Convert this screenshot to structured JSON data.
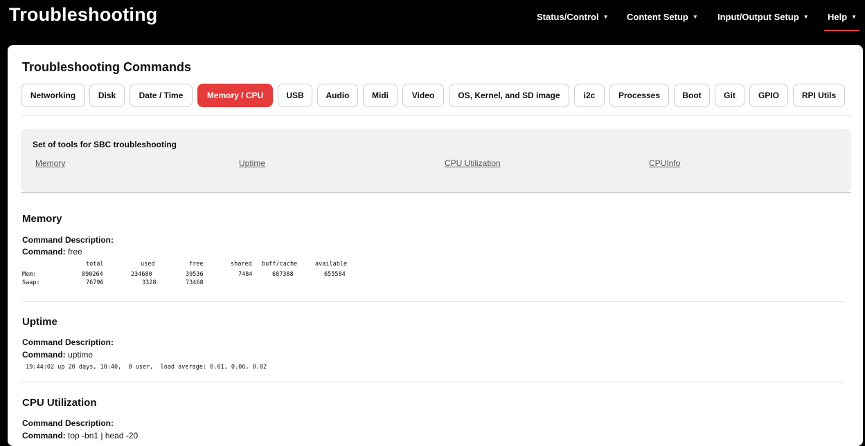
{
  "app": {
    "title": "Troubleshooting"
  },
  "nav": [
    {
      "label": "Status/Control"
    },
    {
      "label": "Content Setup"
    },
    {
      "label": "Input/Output Setup"
    },
    {
      "label": "Help"
    }
  ],
  "section_title": "Troubleshooting Commands",
  "tabs": [
    {
      "label": "Networking"
    },
    {
      "label": "Disk"
    },
    {
      "label": "Date / Time"
    },
    {
      "label": "Memory / CPU",
      "active": true
    },
    {
      "label": "USB"
    },
    {
      "label": "Audio"
    },
    {
      "label": "Midi"
    },
    {
      "label": "Video"
    },
    {
      "label": "OS, Kernel, and SD image"
    },
    {
      "label": "i2c"
    },
    {
      "label": "Processes"
    },
    {
      "label": "Boot"
    },
    {
      "label": "Git"
    },
    {
      "label": "GPIO"
    },
    {
      "label": "RPI Utils"
    }
  ],
  "tools": {
    "title": "Set of tools for SBC troubleshooting",
    "links": [
      "Memory",
      "Uptime",
      "CPU Utilization",
      "CPUInfo"
    ]
  },
  "commands": {
    "desc_label": "Command Description:",
    "cmd_label": "Command:",
    "memory": {
      "heading": "Memory",
      "command": "free",
      "columns": [
        "total",
        "used",
        "free",
        "shared",
        "buff/cache",
        "available"
      ],
      "rows": [
        [
          "Mem:",
          "890264",
          "234680",
          "39536",
          "7484",
          "687388",
          "655584"
        ],
        [
          "Swap:",
          "76796",
          "3328",
          "73468",
          "",
          "",
          ""
        ]
      ]
    },
    "uptime": {
      "heading": "Uptime",
      "command": "uptime",
      "output": " 19:44:02 up 20 days, 10:40,  0 user,  load average: 0.01, 0.06, 0.02"
    },
    "cpu": {
      "heading": "CPU Utilization",
      "command": "top -bn1 | head -20"
    }
  },
  "colors": {
    "accent": "#e53b3b",
    "topbar": "#000000",
    "tools_bg": "#f1f1f1"
  }
}
